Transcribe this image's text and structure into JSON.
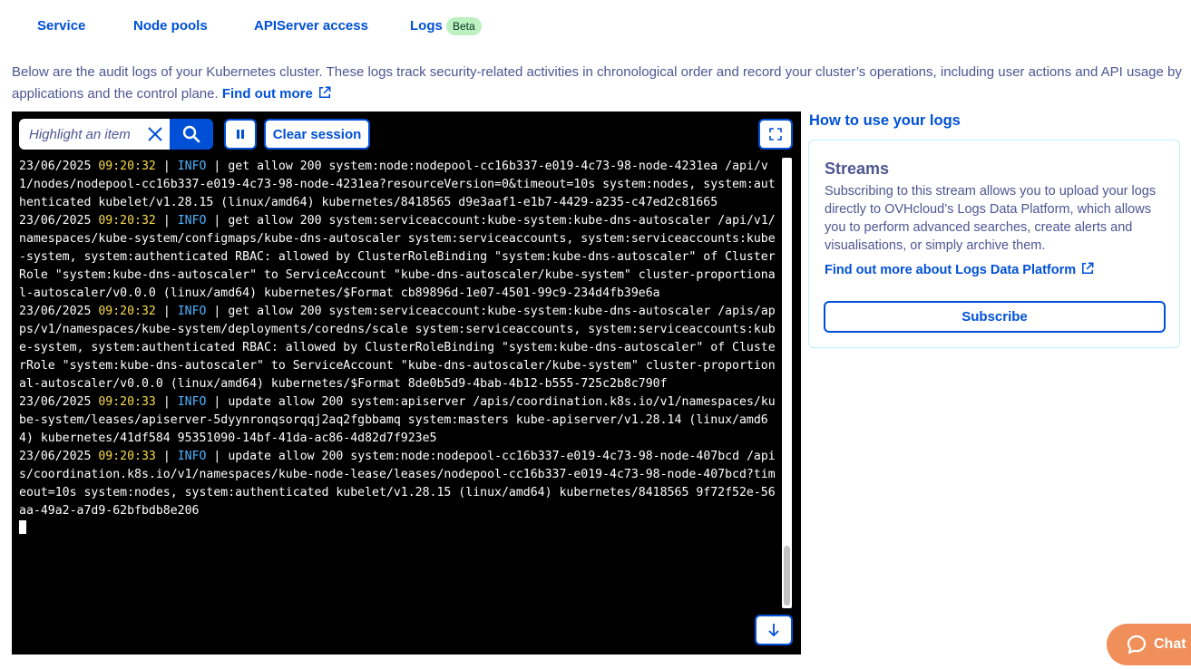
{
  "tabs": [
    {
      "label": "Service"
    },
    {
      "label": "Node pools"
    },
    {
      "label": "APIServer access"
    },
    {
      "label": "Logs",
      "badge": "Beta"
    }
  ],
  "intro": {
    "text": "Below are the audit logs of your Kubernetes cluster. These logs track security-related activities in chronological order and record your cluster’s operations, including user actions and API usage by applications and the control plane.",
    "link": "Find out more"
  },
  "toolbar": {
    "search_placeholder": "Highlight an item",
    "clear_session_label": "Clear session"
  },
  "logs": [
    {
      "date": "23/06/2025",
      "time": "09:20:32",
      "level": "INFO",
      "message": "get allow 200 system:node:nodepool-cc16b337-e019-4c73-98-node-4231ea /api/v1/nodes/nodepool-cc16b337-e019-4c73-98-node-4231ea?resourceVersion=0&timeout=10s system:nodes, system:authenticated kubelet/v1.28.15 (linux/amd64) kubernetes/8418565 d9e3aaf1-e1b7-4429-a235-c47ed2c81665"
    },
    {
      "date": "23/06/2025",
      "time": "09:20:32",
      "level": "INFO",
      "message": "get allow 200 system:serviceaccount:kube-system:kube-dns-autoscaler /api/v1/namespaces/kube-system/configmaps/kube-dns-autoscaler system:serviceaccounts, system:serviceaccounts:kube-system, system:authenticated RBAC: allowed by ClusterRoleBinding \"system:kube-dns-autoscaler\" of ClusterRole \"system:kube-dns-autoscaler\" to ServiceAccount \"kube-dns-autoscaler/kube-system\" cluster-proportional-autoscaler/v0.0.0 (linux/amd64) kubernetes/$Format cb89896d-1e07-4501-99c9-234d4fb39e6a"
    },
    {
      "date": "23/06/2025",
      "time": "09:20:32",
      "level": "INFO",
      "message": "get allow 200 system:serviceaccount:kube-system:kube-dns-autoscaler /apis/apps/v1/namespaces/kube-system/deployments/coredns/scale system:serviceaccounts, system:serviceaccounts:kube-system, system:authenticated RBAC: allowed by ClusterRoleBinding \"system:kube-dns-autoscaler\" of ClusterRole \"system:kube-dns-autoscaler\" to ServiceAccount \"kube-dns-autoscaler/kube-system\" cluster-proportional-autoscaler/v0.0.0 (linux/amd64) kubernetes/$Format 8de0b5d9-4bab-4b12-b555-725c2b8c790f"
    },
    {
      "date": "23/06/2025",
      "time": "09:20:33",
      "level": "INFO",
      "message": "update allow 200 system:apiserver /apis/coordination.k8s.io/v1/namespaces/kube-system/leases/apiserver-5dyynronqsorqqj2aq2fgbbamq system:masters kube-apiserver/v1.28.14 (linux/amd64) kubernetes/41df584 95351090-14bf-41da-ac86-4d82d7f923e5"
    },
    {
      "date": "23/06/2025",
      "time": "09:20:33",
      "level": "INFO",
      "message": "update allow 200 system:node:nodepool-cc16b337-e019-4c73-98-node-407bcd /apis/coordination.k8s.io/v1/namespaces/kube-node-lease/leases/nodepool-cc16b337-e019-4c73-98-node-407bcd?timeout=10s system:nodes, system:authenticated kubelet/v1.28.15 (linux/amd64) kubernetes/8418565 9f72f52e-56aa-49a2-a7d9-62bfbdb8e206"
    }
  ],
  "sidebar": {
    "title": "How to use your logs",
    "card": {
      "title": "Streams",
      "body": "Subscribing to this stream allows you to upload your logs directly to OVHcloud’s Logs Data Platform, which allows you to perform advanced searches, create alerts and visualisations, or simply archive them.",
      "link": "Find out more about Logs Data Platform",
      "button": "Subscribe"
    }
  },
  "chat": {
    "label": "Chat"
  },
  "colors": {
    "primary": "#0050d7",
    "text": "#4d5693",
    "time": "#f7d94c",
    "level": "#4fb3ff",
    "chat": "#f18f5a",
    "beta": "#bef1c2"
  }
}
